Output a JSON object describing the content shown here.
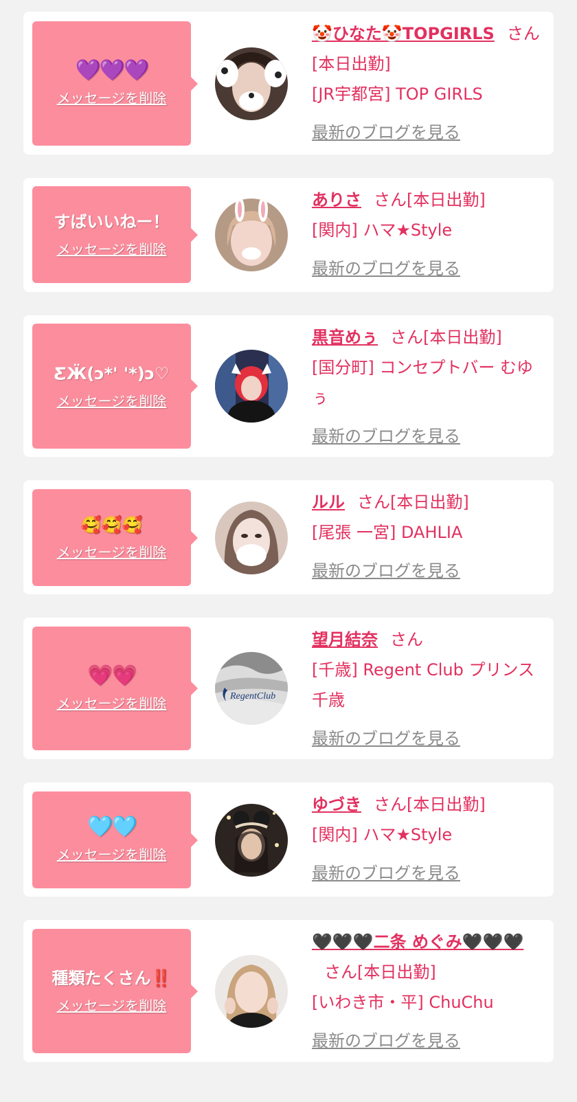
{
  "common": {
    "delete_label": "メッセージを削除",
    "blog_label": "最新のブログを見る"
  },
  "cards": [
    {
      "message": "💜💜💜",
      "name": "🤡ひなた🤡TOPGIRLS",
      "suffix": "さん[本日出勤]",
      "shop": "[JR宇都宮] TOP GIRLS"
    },
    {
      "message": "すばいいねー！",
      "name": "ありさ",
      "suffix": "さん[本日出勤]",
      "shop": "[関内] ハマ★Style"
    },
    {
      "message": "ƸӜ(ↄ*' '*)ↄ♡",
      "name": "黒音めぅ",
      "suffix": "さん[本日出勤]",
      "shop": "[国分町] コンセプトバー むゆぅ"
    },
    {
      "message": "🥰🥰🥰",
      "name": "ルル",
      "suffix": "さん[本日出勤]",
      "shop": "[尾張 一宮] DAHLIA"
    },
    {
      "message": "💗💗",
      "name": "望月結奈",
      "suffix": "さん",
      "shop": "[千歳] Regent Club プリンス 千歳",
      "avatar_text": "RegentClub"
    },
    {
      "message": "🩵🩵",
      "name": "ゆづき",
      "suffix": "さん[本日出勤]",
      "shop": "[関内] ハマ★Style"
    },
    {
      "message": "種類たくさん‼️",
      "name": "🖤🖤🖤二条 めぐみ🖤🖤🖤",
      "suffix": "さん[本日出勤]",
      "shop": "[いわき市・平] ChuChu"
    }
  ],
  "colors": {
    "bubble": "#fc8d9d",
    "accent": "#e2305f",
    "muted": "#8b8b8b",
    "background": "#f2f2f2"
  }
}
